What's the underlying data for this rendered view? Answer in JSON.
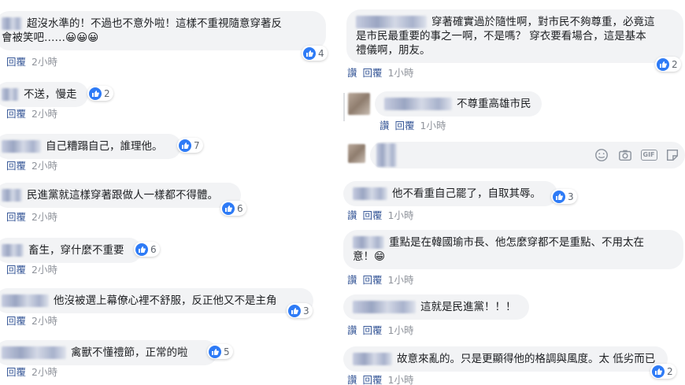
{
  "left_comments": [
    {
      "text": "超沒水準的！不過也不意外啦！這樣不重視隨意穿著反",
      "text2": "會被笑吧……😀😀😀",
      "likes": "4",
      "reply": "回覆",
      "time": "2小時"
    },
    {
      "text": "不送，慢走",
      "likes": "2",
      "reply": "回覆",
      "time": "2小時"
    },
    {
      "text": "自己糟蹋自己，誰理他。",
      "likes": "7",
      "reply": "回覆",
      "time": "2小時"
    },
    {
      "text": "民進黨就這樣穿著跟做人一樣都不得體。",
      "likes": "6",
      "reply": "回覆",
      "time": "2小時"
    },
    {
      "text": "畜生，穿什麼不重要",
      "likes": "6",
      "reply": "回覆",
      "time": "2小時"
    },
    {
      "text": "他沒被選上幕僚心裡不舒服，反正他又不是主角",
      "likes": "3",
      "reply": "回覆",
      "time": "2小時"
    },
    {
      "text": "禽獸不懂禮節，正常的啦",
      "likes": "5",
      "reply": "回覆",
      "time": "2小時"
    }
  ],
  "right_comments": [
    {
      "text": "穿著確實過於隨性啊，對市民不夠尊重，必竟這",
      "text2": "是市民最重要的事之一啊，不是嗎？ 穿衣要看場合，這是基本",
      "text3": "禮儀啊，朋友。",
      "likes": "2",
      "like": "讚",
      "reply": "回覆",
      "time": "1小時"
    },
    {
      "text": "不尊重高雄市民",
      "like": "讚",
      "reply": "回覆",
      "time": "1小時"
    },
    {
      "text": "他不看重自己罷了，自取其辱。",
      "likes": "3",
      "like": "讚",
      "reply": "回覆",
      "time": "1小時"
    },
    {
      "text": "重點是在韓國瑜市長、他怎麼穿都不是重點、不用太在",
      "text2": "意！😁",
      "like": "讚",
      "reply": "回覆",
      "time": "1小時"
    },
    {
      "text": "這就是民進黨！！！",
      "like": "讚",
      "reply": "回覆",
      "time": "1小時"
    },
    {
      "text": "故意來亂的。只是更顯得他的格調與風度。太 低劣而已",
      "likes": "2",
      "like": "讚",
      "reply": "回覆",
      "time": "1小時"
    }
  ],
  "reply_box": {
    "placeholder": "",
    "icons": [
      "emoji-icon",
      "camera-icon",
      "gif-icon",
      "sticker-icon"
    ]
  },
  "colors": {
    "bubble": "#f2f3f5",
    "like": "#2e7bf6",
    "link": "#385898",
    "time": "#90949c"
  }
}
